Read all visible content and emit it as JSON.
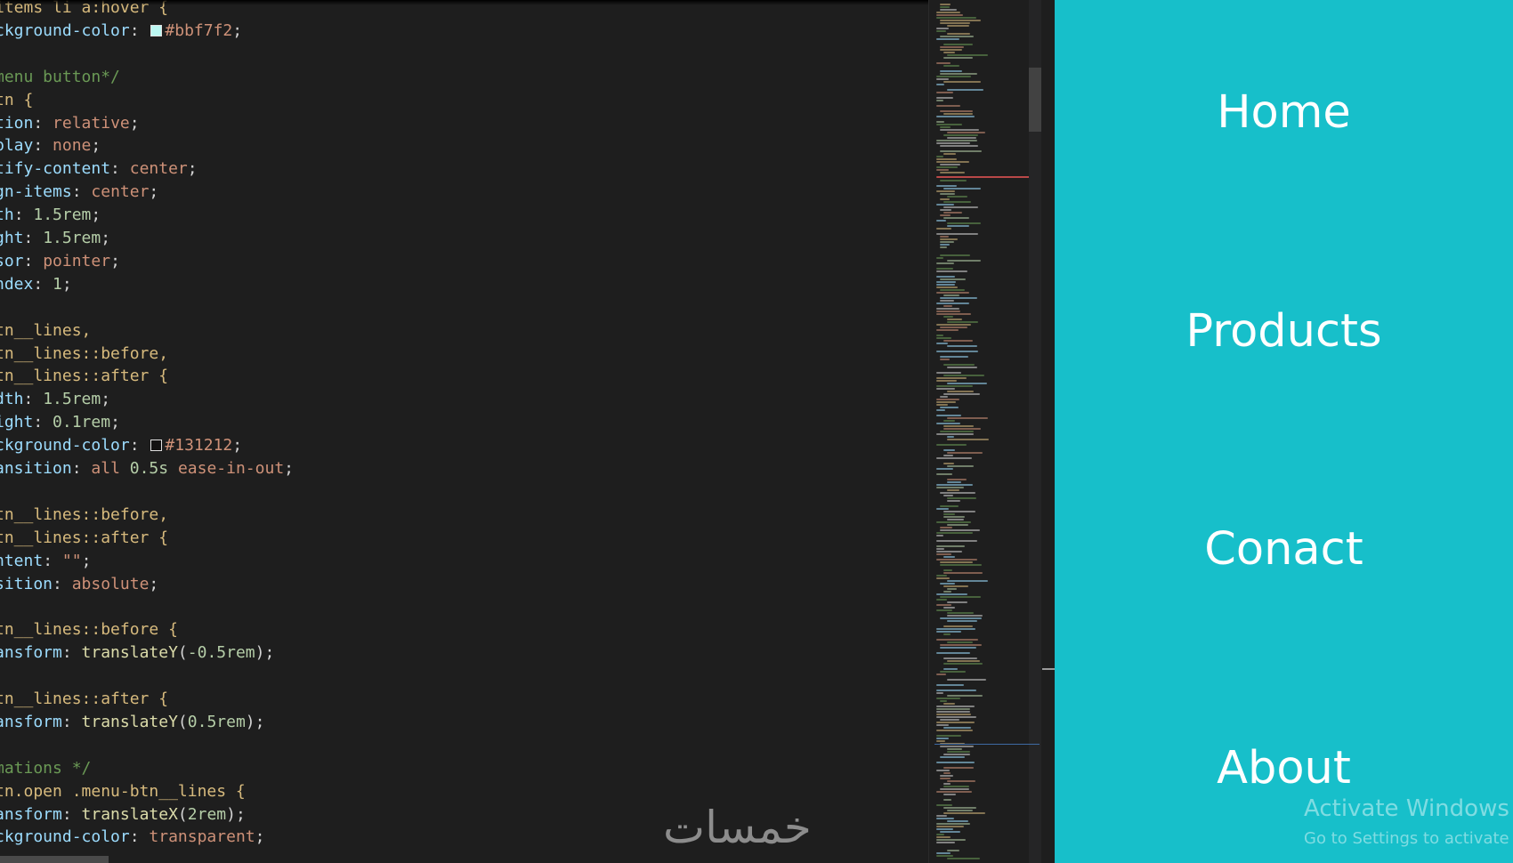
{
  "editor": {
    "lines": [
      [
        {
          "t": "items li a:hover {",
          "c": "sel"
        }
      ],
      [
        {
          "t": "ckground-color",
          "c": "prop"
        },
        {
          "t": ": ",
          "c": "punc"
        },
        {
          "sw": "#bbf7f2"
        },
        {
          "t": "#bbf7f2",
          "c": "color"
        },
        {
          "t": ";",
          "c": "punc"
        }
      ],
      [],
      [
        {
          "t": "menu button*/",
          "c": "com"
        }
      ],
      [
        {
          "t": "tn {",
          "c": "sel"
        }
      ],
      [
        {
          "t": "tion",
          "c": "prop"
        },
        {
          "t": ": ",
          "c": "punc"
        },
        {
          "t": "relative",
          "c": "val"
        },
        {
          "t": ";",
          "c": "punc"
        }
      ],
      [
        {
          "t": "play",
          "c": "prop"
        },
        {
          "t": ": ",
          "c": "punc"
        },
        {
          "t": "none",
          "c": "val"
        },
        {
          "t": ";",
          "c": "punc"
        }
      ],
      [
        {
          "t": "tify-content",
          "c": "prop"
        },
        {
          "t": ": ",
          "c": "punc"
        },
        {
          "t": "center",
          "c": "val"
        },
        {
          "t": ";",
          "c": "punc"
        }
      ],
      [
        {
          "t": "gn-items",
          "c": "prop"
        },
        {
          "t": ": ",
          "c": "punc"
        },
        {
          "t": "center",
          "c": "val"
        },
        {
          "t": ";",
          "c": "punc"
        }
      ],
      [
        {
          "t": "th",
          "c": "prop"
        },
        {
          "t": ": ",
          "c": "punc"
        },
        {
          "t": "1.5rem",
          "c": "num"
        },
        {
          "t": ";",
          "c": "punc"
        }
      ],
      [
        {
          "t": "ght",
          "c": "prop"
        },
        {
          "t": ": ",
          "c": "punc"
        },
        {
          "t": "1.5rem",
          "c": "num"
        },
        {
          "t": ";",
          "c": "punc"
        }
      ],
      [
        {
          "t": "sor",
          "c": "prop"
        },
        {
          "t": ": ",
          "c": "punc"
        },
        {
          "t": "pointer",
          "c": "val"
        },
        {
          "t": ";",
          "c": "punc"
        }
      ],
      [
        {
          "t": "ndex",
          "c": "prop"
        },
        {
          "t": ": ",
          "c": "punc"
        },
        {
          "t": "1",
          "c": "num"
        },
        {
          "t": ";",
          "c": "punc"
        }
      ],
      [],
      [
        {
          "t": "tn__lines,",
          "c": "sel"
        }
      ],
      [
        {
          "t": "tn__lines::before,",
          "c": "sel"
        }
      ],
      [
        {
          "t": "tn__lines::after {",
          "c": "sel"
        }
      ],
      [
        {
          "t": "dth",
          "c": "prop"
        },
        {
          "t": ": ",
          "c": "punc"
        },
        {
          "t": "1.5rem",
          "c": "num"
        },
        {
          "t": ";",
          "c": "punc"
        }
      ],
      [
        {
          "t": "ight",
          "c": "prop"
        },
        {
          "t": ": ",
          "c": "punc"
        },
        {
          "t": "0.1rem",
          "c": "num"
        },
        {
          "t": ";",
          "c": "punc"
        }
      ],
      [
        {
          "t": "ckground-color",
          "c": "prop"
        },
        {
          "t": ": ",
          "c": "punc"
        },
        {
          "sw": "#131212"
        },
        {
          "t": "#131212",
          "c": "color"
        },
        {
          "t": ";",
          "c": "punc"
        }
      ],
      [
        {
          "t": "ansition",
          "c": "prop"
        },
        {
          "t": ": ",
          "c": "punc"
        },
        {
          "t": "all ",
          "c": "val"
        },
        {
          "t": "0.5s",
          "c": "num"
        },
        {
          "t": " ease-in-out",
          "c": "val"
        },
        {
          "t": ";",
          "c": "punc"
        }
      ],
      [],
      [
        {
          "t": "tn__lines::before,",
          "c": "sel"
        }
      ],
      [
        {
          "t": "tn__lines::after {",
          "c": "sel"
        }
      ],
      [
        {
          "t": "ntent",
          "c": "prop"
        },
        {
          "t": ": ",
          "c": "punc"
        },
        {
          "t": "\"\"",
          "c": "val"
        },
        {
          "t": ";",
          "c": "punc"
        }
      ],
      [
        {
          "t": "sition",
          "c": "prop"
        },
        {
          "t": ": ",
          "c": "punc"
        },
        {
          "t": "absolute",
          "c": "val"
        },
        {
          "t": ";",
          "c": "punc"
        }
      ],
      [],
      [
        {
          "t": "tn__lines::before {",
          "c": "sel"
        }
      ],
      [
        {
          "t": "ansform",
          "c": "prop"
        },
        {
          "t": ": ",
          "c": "punc"
        },
        {
          "t": "translateY",
          "c": "fn"
        },
        {
          "t": "(",
          "c": "punc"
        },
        {
          "t": "-0.5rem",
          "c": "num"
        },
        {
          "t": ");",
          "c": "punc"
        }
      ],
      [],
      [
        {
          "t": "tn__lines::after {",
          "c": "sel"
        }
      ],
      [
        {
          "t": "ansform",
          "c": "prop"
        },
        {
          "t": ": ",
          "c": "punc"
        },
        {
          "t": "translateY",
          "c": "fn"
        },
        {
          "t": "(",
          "c": "punc"
        },
        {
          "t": "0.5rem",
          "c": "num"
        },
        {
          "t": ");",
          "c": "punc"
        }
      ],
      [],
      [
        {
          "t": "mations */",
          "c": "com"
        }
      ],
      [
        {
          "t": "tn.open .menu-btn__lines {",
          "c": "sel"
        }
      ],
      [
        {
          "t": "ansform",
          "c": "prop"
        },
        {
          "t": ": ",
          "c": "punc"
        },
        {
          "t": "translateX",
          "c": "fn"
        },
        {
          "t": "(",
          "c": "punc"
        },
        {
          "t": "2rem",
          "c": "num"
        },
        {
          "t": ");",
          "c": "punc"
        }
      ],
      [
        {
          "t": "ckground-color",
          "c": "prop"
        },
        {
          "t": ": ",
          "c": "punc"
        },
        {
          "t": "transparent",
          "c": "val"
        },
        {
          "t": ";",
          "c": "punc"
        }
      ]
    ],
    "watermark": "خمسات"
  },
  "preview": {
    "background": "#17bfca",
    "nav": [
      {
        "label": "Home"
      },
      {
        "label": "Products"
      },
      {
        "label": "Conact"
      },
      {
        "label": "About"
      }
    ],
    "activate_title": "Activate Windows",
    "activate_sub": "Go to Settings to activate W"
  }
}
